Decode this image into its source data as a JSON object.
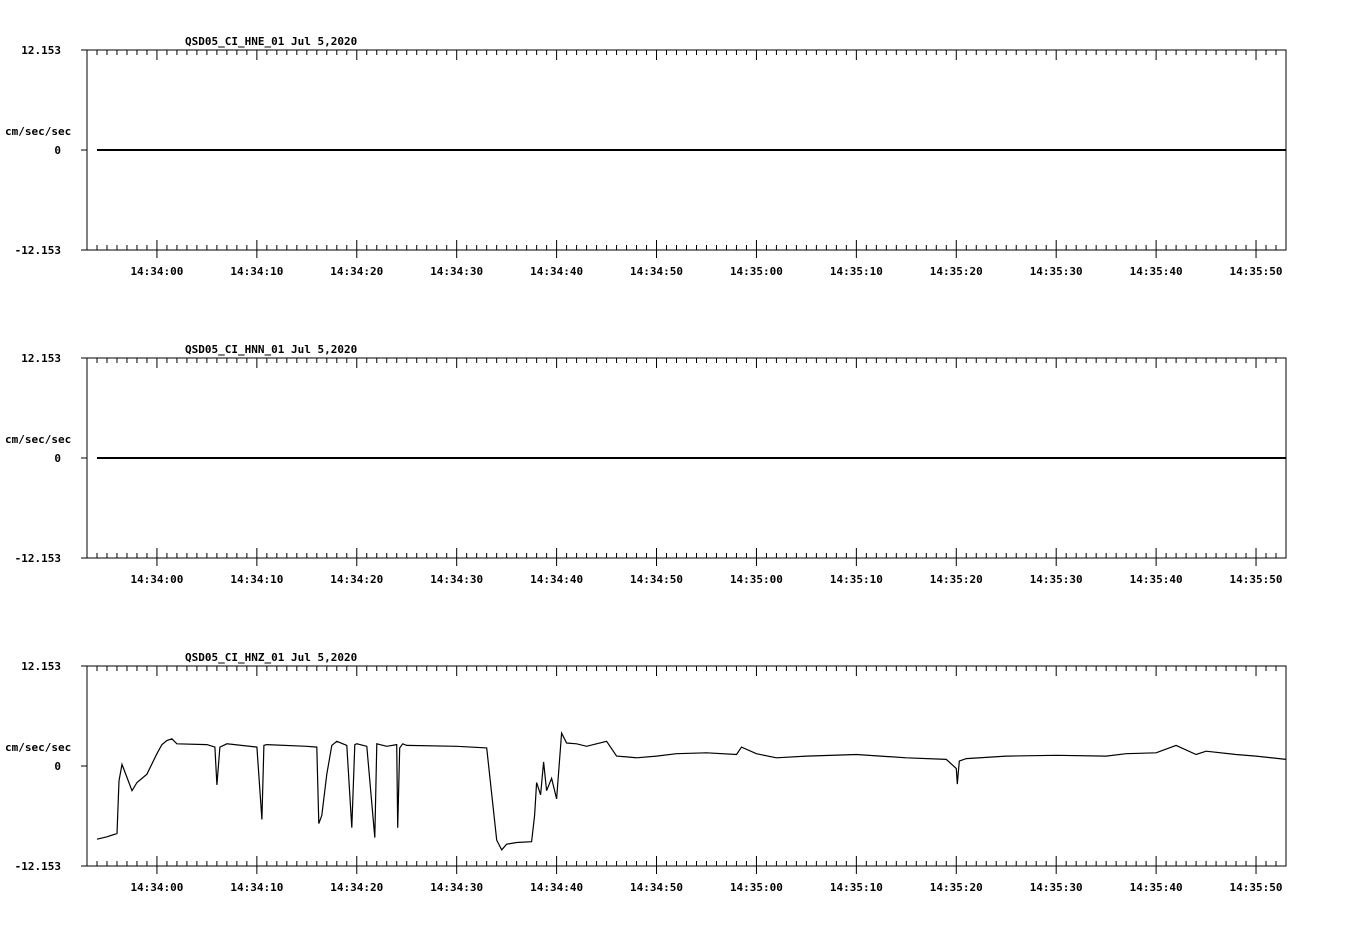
{
  "page": {
    "background": "#ffffff",
    "ink_color": "#000000"
  },
  "chart_data": [
    {
      "type": "line",
      "title": "QSD05_CI_HNE_01  Jul 5,2020",
      "ylabel": "cm/sec/sec",
      "ytick_labels": [
        "12.153",
        "0",
        "-12.153"
      ],
      "ylim": [
        -12.153,
        12.153
      ],
      "xlim": [
        "14:33:53",
        "14:35:53"
      ],
      "xtick_labels": [
        "14:34:00",
        "14:34:10",
        "14:34:20",
        "14:34:30",
        "14:34:40",
        "14:34:50",
        "14:35:00",
        "14:35:10",
        "14:35:20",
        "14:35:30",
        "14:35:40",
        "14:35:50"
      ],
      "series": [
        {
          "x": [
            "14:33:54",
            "14:35:53"
          ],
          "y": [
            0,
            0
          ]
        }
      ]
    },
    {
      "type": "line",
      "title": "QSD05_CI_HNN_01  Jul 5,2020",
      "ylabel": "cm/sec/sec",
      "ytick_labels": [
        "12.153",
        "0",
        "-12.153"
      ],
      "ylim": [
        -12.153,
        12.153
      ],
      "xlim": [
        "14:33:53",
        "14:35:53"
      ],
      "xtick_labels": [
        "14:34:00",
        "14:34:10",
        "14:34:20",
        "14:34:30",
        "14:34:40",
        "14:34:50",
        "14:35:00",
        "14:35:10",
        "14:35:20",
        "14:35:30",
        "14:35:40",
        "14:35:50"
      ],
      "series": [
        {
          "x": [
            "14:33:54",
            "14:35:53"
          ],
          "y": [
            0,
            0
          ]
        }
      ]
    },
    {
      "type": "line",
      "title": "QSD05_CI_HNZ_01  Jul 5,2020",
      "ylabel": "cm/sec/sec",
      "ytick_labels": [
        "12.153",
        "0",
        "-12.153"
      ],
      "ylim": [
        -12.153,
        12.153
      ],
      "xlim": [
        "14:33:53",
        "14:35:53"
      ],
      "xtick_labels": [
        "14:34:00",
        "14:34:10",
        "14:34:20",
        "14:34:30",
        "14:34:40",
        "14:34:50",
        "14:35:00",
        "14:35:10",
        "14:35:20",
        "14:35:30",
        "14:35:40",
        "14:35:50"
      ],
      "series": [
        {
          "x": [
            "14:33:54",
            "14:33:55",
            "14:33:56",
            "14:33:56.2",
            "14:33:56.5",
            "14:33:57",
            "14:33:57.5",
            "14:33:58",
            "14:33:59",
            "14:34:00",
            "14:34:00.5",
            "14:34:01",
            "14:34:01.5",
            "14:34:02",
            "14:34:05",
            "14:34:05.8",
            "14:34:06",
            "14:34:06.3",
            "14:34:07",
            "14:34:10",
            "14:34:10.5",
            "14:34:10.7",
            "14:34:11",
            "14:34:15",
            "14:34:16",
            "14:34:16.2",
            "14:34:16.5",
            "14:34:17",
            "14:34:17.5",
            "14:34:18",
            "14:34:19",
            "14:34:19.5",
            "14:34:19.8",
            "14:34:20",
            "14:34:21",
            "14:34:21.8",
            "14:34:22",
            "14:34:22.3",
            "14:34:23",
            "14:34:24",
            "14:34:24.1",
            "14:34:24.3",
            "14:34:24.6",
            "14:34:25",
            "14:34:30",
            "14:34:33",
            "14:34:34",
            "14:34:34.5",
            "14:34:35",
            "14:34:36",
            "14:34:37.5",
            "14:34:37.8",
            "14:34:38",
            "14:34:38.4",
            "14:34:38.7",
            "14:34:39",
            "14:34:39.5",
            "14:34:40",
            "14:34:40.5",
            "14:34:41",
            "14:34:42",
            "14:34:43",
            "14:34:45",
            "14:34:46",
            "14:34:47",
            "14:34:48",
            "14:34:50",
            "14:34:52",
            "14:34:55",
            "14:34:58",
            "14:34:58.5",
            "14:35:00",
            "14:35:02",
            "14:35:05",
            "14:35:10",
            "14:35:15",
            "14:35:19",
            "14:35:20",
            "14:35:20.1",
            "14:35:20.3",
            "14:35:21",
            "14:35:25",
            "14:35:30",
            "14:35:35",
            "14:35:37",
            "14:35:40",
            "14:35:42",
            "14:35:44",
            "14:35:45",
            "14:35:48",
            "14:35:50",
            "14:35:53"
          ],
          "y": [
            -8.9,
            -8.6,
            -8.2,
            -1.8,
            0.2,
            -1.4,
            -3.0,
            -2.0,
            -1.0,
            1.5,
            2.6,
            3.1,
            3.3,
            2.7,
            2.6,
            2.3,
            -2.3,
            2.3,
            2.7,
            2.3,
            -6.5,
            2.5,
            2.6,
            2.4,
            2.3,
            -7.0,
            -6.0,
            -1.0,
            2.5,
            3.0,
            2.5,
            -7.5,
            2.6,
            2.7,
            2.4,
            -8.7,
            2.7,
            2.6,
            2.4,
            2.6,
            -7.5,
            2.2,
            2.7,
            2.5,
            2.4,
            2.2,
            -9.0,
            -10.2,
            -9.5,
            -9.3,
            -9.2,
            -6.0,
            -2.0,
            -3.5,
            0.5,
            -3.0,
            -1.5,
            -4.0,
            4.0,
            2.8,
            2.7,
            2.4,
            3.0,
            1.2,
            1.1,
            1.0,
            1.2,
            1.5,
            1.6,
            1.4,
            2.3,
            1.5,
            1.0,
            1.2,
            1.4,
            1.0,
            0.8,
            -0.3,
            -2.2,
            0.6,
            0.9,
            1.2,
            1.3,
            1.2,
            1.5,
            1.6,
            2.5,
            1.4,
            1.8,
            1.4,
            1.2,
            0.8
          ]
        }
      ]
    }
  ]
}
